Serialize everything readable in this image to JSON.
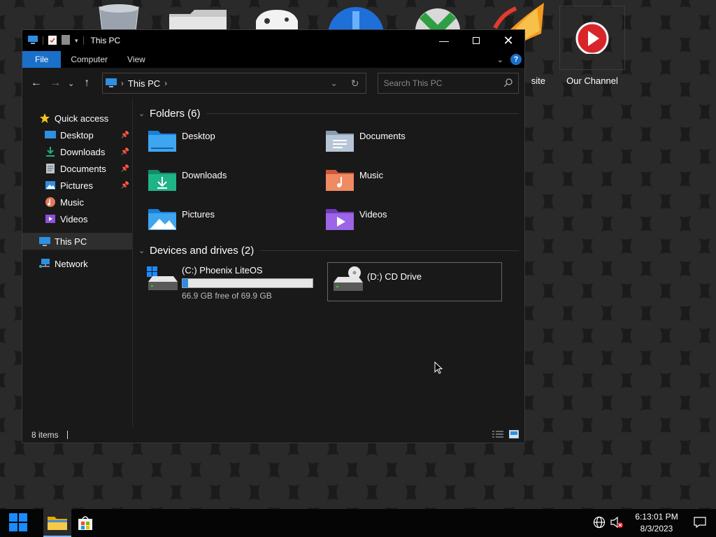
{
  "desktop": {
    "icons": [
      {
        "label": "site",
        "icon": "website-globe-icon"
      },
      {
        "label": "Our Channel",
        "icon": "play-button-icon"
      }
    ]
  },
  "window": {
    "title": "This PC",
    "ribbon_tabs": [
      "File",
      "Computer",
      "View"
    ],
    "help_label": "?",
    "address": {
      "path": "This PC"
    },
    "search": {
      "placeholder": "Search This PC"
    },
    "nav": {
      "quick_access": "Quick access",
      "pinned": [
        "Desktop",
        "Downloads",
        "Documents",
        "Pictures"
      ],
      "others": [
        "Music",
        "Videos"
      ],
      "this_pc": "This PC",
      "network": "Network"
    },
    "folders_header": "Folders (6)",
    "folders": [
      "Desktop",
      "Documents",
      "Downloads",
      "Music",
      "Pictures",
      "Videos"
    ],
    "drives_header": "Devices and drives (2)",
    "drives": [
      {
        "name": "(C:) Phoenix LiteOS",
        "free_text": "66.9 GB free of 69.9 GB",
        "used_fraction": 0.043
      },
      {
        "name": "(D:) CD Drive"
      }
    ],
    "status": {
      "items": "8 items"
    }
  },
  "taskbar": {
    "clock_time": "6:13:01 PM",
    "clock_date": "8/3/2023"
  },
  "colors": {
    "accent": "#1a6fc9",
    "progress": "#2b8be6"
  }
}
